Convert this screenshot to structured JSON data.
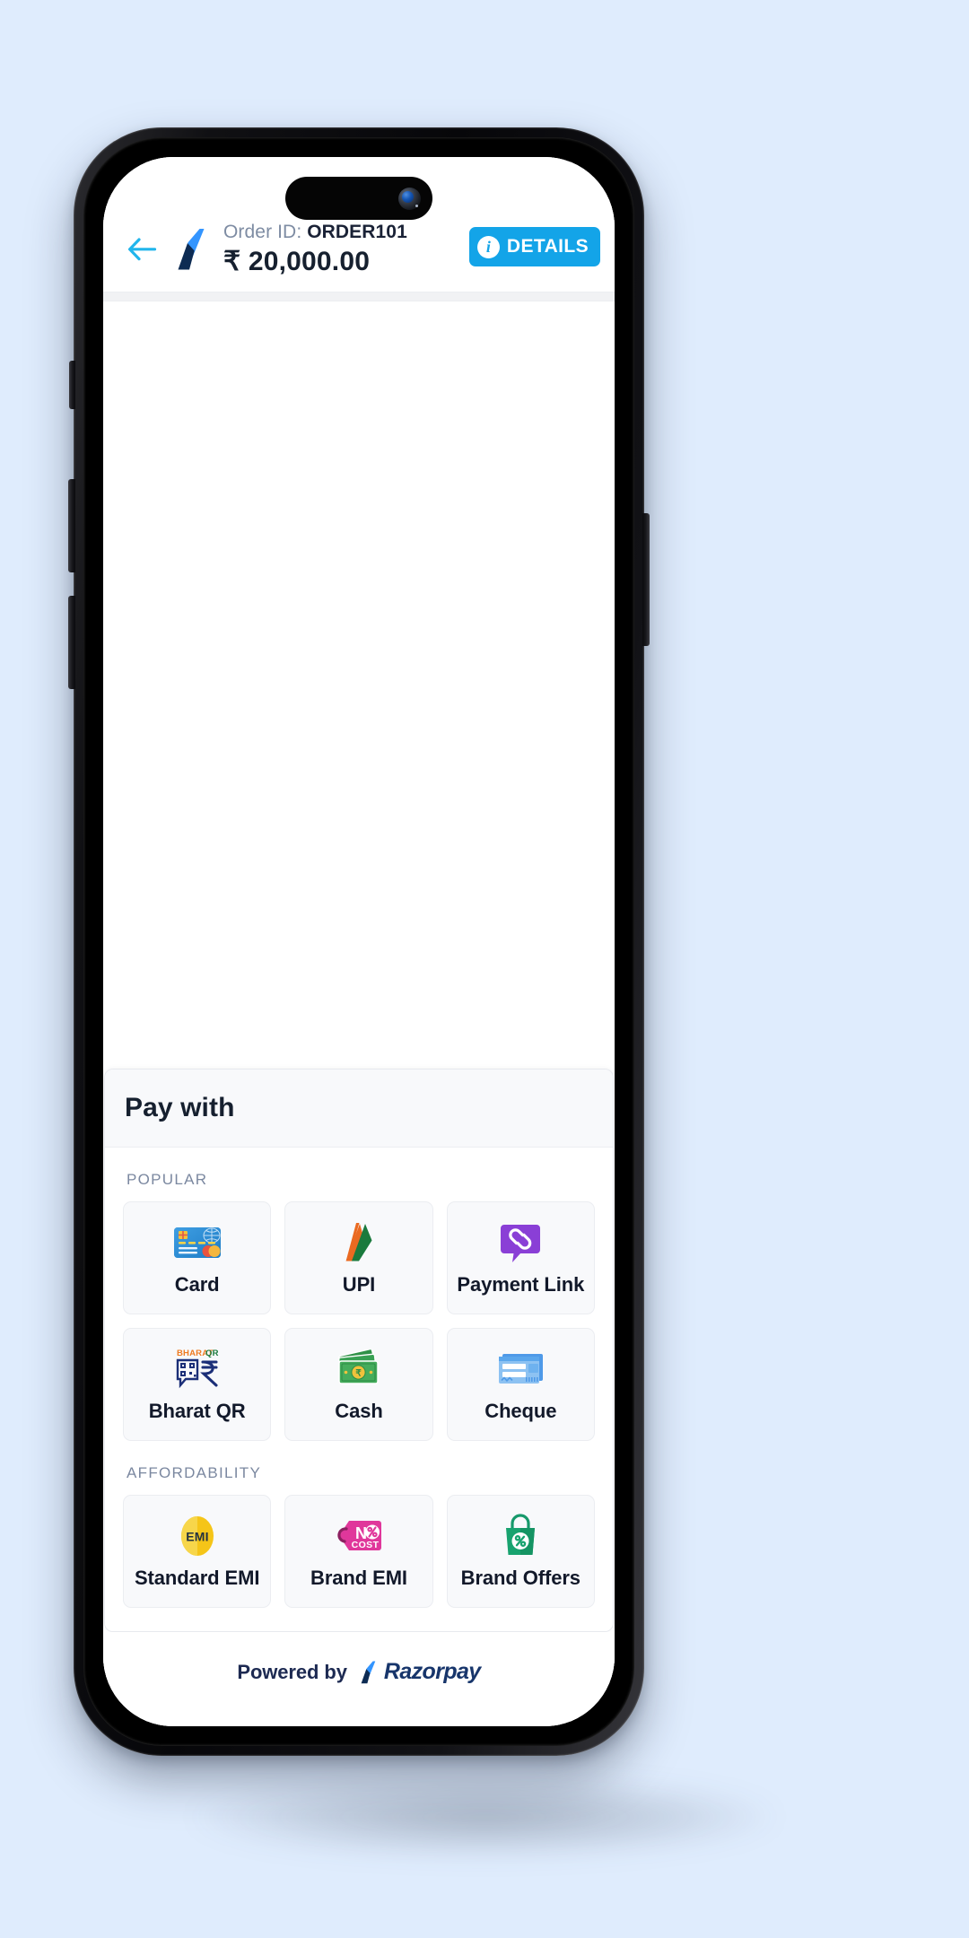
{
  "page": {
    "background_color": "#dfecfd"
  },
  "device": {
    "frame": "iphone-pro",
    "island": "dynamic-island"
  },
  "header": {
    "back_icon": "back-arrow-icon",
    "merchant_logo": "razorpay-logo-icon",
    "order_label": "Order ID: ",
    "order_id": "ORDER101",
    "amount": "₹ 20,000.00",
    "details_button": {
      "label": "DETAILS",
      "icon": "info-icon",
      "color": "#13a4e8"
    }
  },
  "sheet": {
    "title": "Pay with",
    "groups": [
      {
        "label": "POPULAR",
        "methods": [
          {
            "label": "Card",
            "icon": "credit-card-icon"
          },
          {
            "label": "UPI",
            "icon": "upi-icon"
          },
          {
            "label": "Payment Link",
            "icon": "payment-link-icon"
          },
          {
            "label": "Bharat QR",
            "icon": "bharat-qr-icon"
          },
          {
            "label": "Cash",
            "icon": "cash-icon"
          },
          {
            "label": "Cheque",
            "icon": "cheque-icon"
          }
        ]
      },
      {
        "label": "AFFORDABILITY",
        "methods": [
          {
            "label": "Standard EMI",
            "icon": "emi-badge-icon"
          },
          {
            "label": "Brand EMI",
            "icon": "no-cost-tag-icon"
          },
          {
            "label": "Brand Offers",
            "icon": "offers-bag-icon"
          }
        ]
      }
    ]
  },
  "footer": {
    "powered_by": "Powered by",
    "brand": "Razorpay",
    "brand_icon": "razorpay-logo-icon"
  },
  "colors": {
    "accent_blue": "#13a4e8",
    "brand_navy": "#17356b",
    "brand_blue": "#3395ff",
    "muted_text": "#7b88a0",
    "tile_bg": "#f8f9fb"
  }
}
